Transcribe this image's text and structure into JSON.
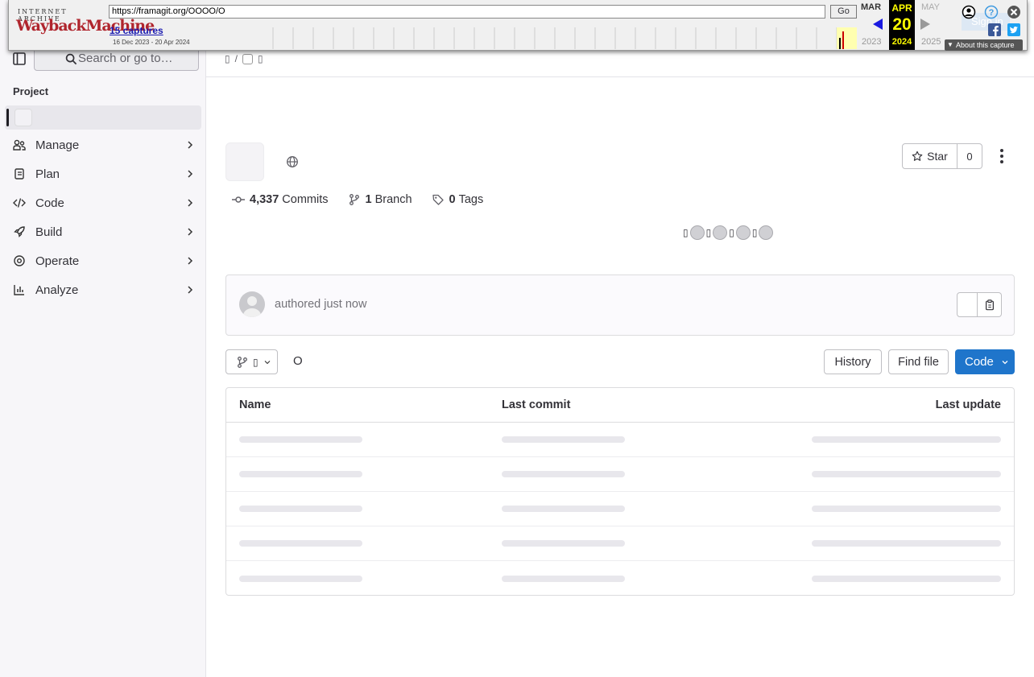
{
  "sidebar": {
    "search_placeholder": "Search or go to…",
    "section_title": "Project",
    "project_name": "",
    "items": [
      {
        "label": "Manage",
        "icon": "users-icon"
      },
      {
        "label": "Plan",
        "icon": "planning-icon"
      },
      {
        "label": "Code",
        "icon": "code-icon"
      },
      {
        "label": "Build",
        "icon": "rocket-icon"
      },
      {
        "label": "Operate",
        "icon": "deployments-icon"
      },
      {
        "label": "Analyze",
        "icon": "chart-icon"
      }
    ]
  },
  "project": {
    "title": "",
    "visibility_icon": "globe-icon",
    "star_label": "Star",
    "star_count": "0",
    "stats": {
      "commits_count": "4,337",
      "commits_label": "Commits",
      "branches_count": "1",
      "branches_label": "Branch",
      "tags_count": "0",
      "tags_label": "Tags"
    }
  },
  "commit": {
    "authored_text": "authored just now"
  },
  "repo": {
    "path": "O",
    "history_label": "History",
    "find_file_label": "Find file",
    "code_label": "Code",
    "columns": [
      "Name",
      "Last commit",
      "Last update"
    ],
    "loading_rows": 5
  },
  "wayback": {
    "brand_top": "INTERNET ARCHIVE",
    "brand_main": "WaybackMachine",
    "url": "https://framagit.org/OOOO/O",
    "go_label": "Go",
    "captures": "15 captures",
    "range": "16 Dec 2023 - 20 Apr 2024",
    "prev_month": "MAR",
    "cur_month": "APR",
    "next_month": "MAY",
    "day": "20",
    "prev_year": "2023",
    "cur_year": "2024",
    "next_year": "2025",
    "about_label": "About this capture",
    "signin_label": "Sign in"
  }
}
